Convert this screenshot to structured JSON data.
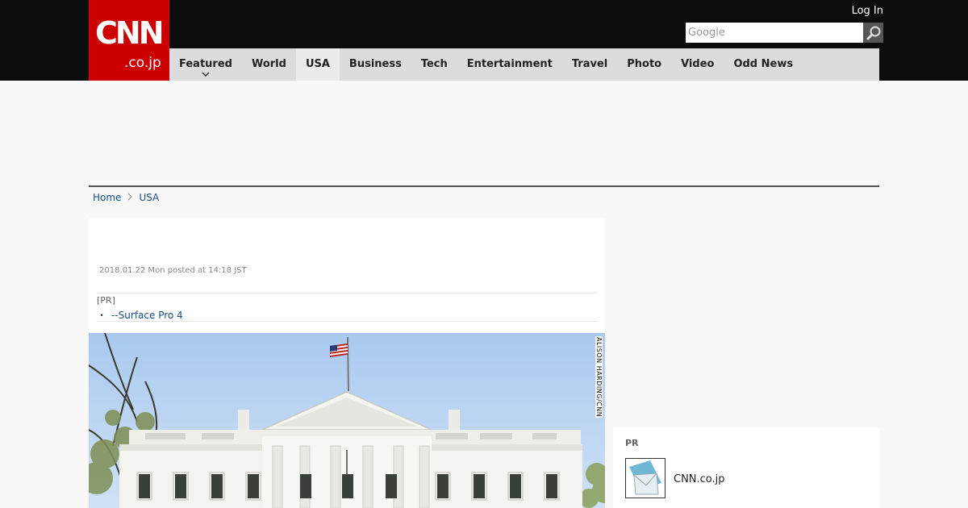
{
  "header": {
    "logo_main": "CNN",
    "logo_sub": ".co.jp",
    "login_label": "Log In",
    "search": {
      "placeholder": "Google",
      "button_icon": "search-icon"
    }
  },
  "nav": {
    "items": [
      {
        "label": "Featured",
        "has_dropdown": true
      },
      {
        "label": "World"
      },
      {
        "label": "USA",
        "active": true
      },
      {
        "label": "Business"
      },
      {
        "label": "Tech"
      },
      {
        "label": "Entertainment"
      },
      {
        "label": "Travel"
      },
      {
        "label": "Photo"
      },
      {
        "label": "Video"
      },
      {
        "label": "Odd News"
      }
    ]
  },
  "breadcrumb": {
    "home": "Home",
    "current": "USA"
  },
  "article": {
    "date": "2018.01.22 Mon posted at 14:18 JST",
    "pr_tag": "[PR]",
    "pr_link_bullet": "・",
    "pr_link": "--Surface Pro 4",
    "photo_credit": "ALISON HARDING/CNN"
  },
  "sidebar": {
    "pr_label": "PR",
    "item_name": "CNN.co.jp"
  },
  "colors": {
    "brand_red": "#cc0000",
    "header_black": "#0c0c0c",
    "nav_gray": "#dcdcdc",
    "link_blue": "#1a4f8a"
  }
}
